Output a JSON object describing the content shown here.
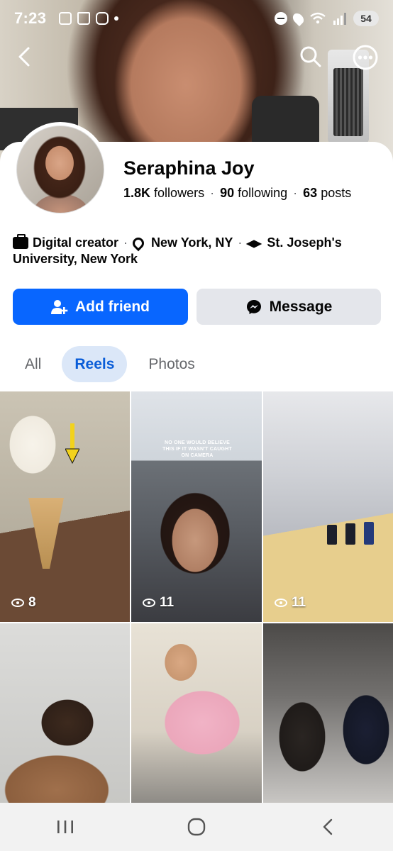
{
  "status_bar": {
    "time": "7:23",
    "battery": "54"
  },
  "profile": {
    "name": "Seraphina Joy",
    "followers_count": "1.8K",
    "followers_label": "followers",
    "following_count": "90",
    "following_label": "following",
    "posts_count": "63",
    "posts_label": "posts"
  },
  "intro": {
    "work": "Digital creator",
    "location": "New York, NY",
    "education_line1": "St. Joseph's",
    "education_line2": "University, New York"
  },
  "actions": {
    "add_friend": "Add friend",
    "message": "Message"
  },
  "tabs": [
    {
      "label": "All",
      "active": false
    },
    {
      "label": "Reels",
      "active": true
    },
    {
      "label": "Photos",
      "active": false
    }
  ],
  "reels": [
    {
      "views": "8"
    },
    {
      "views": "11",
      "caption": "NO ONE WOULD BELIEVE THIS IF IT WASN'T CAUGHT ON CAMERA"
    },
    {
      "views": "11"
    },
    {},
    {},
    {}
  ],
  "colors": {
    "primary_blue": "#0866ff",
    "active_tab_bg": "#dbe7f8",
    "active_tab_text": "#0a5dd8",
    "secondary_button": "#e4e6eb"
  },
  "icons": {
    "back": "back-arrow-icon",
    "search": "search-icon",
    "more": "more-icon",
    "add_friend": "add-person-icon",
    "message": "messenger-icon",
    "work": "briefcase-icon",
    "location": "location-pin-icon",
    "education": "graduation-cap-icon",
    "views": "eye-icon"
  }
}
